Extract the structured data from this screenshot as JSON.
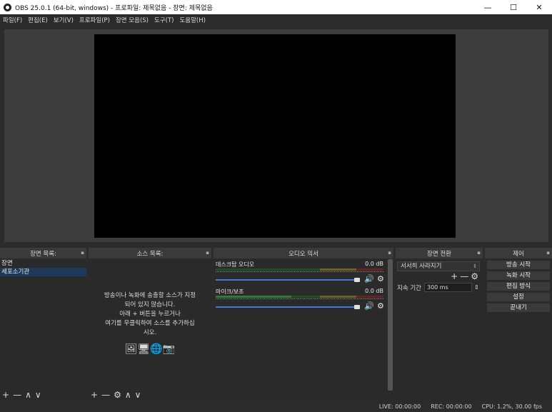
{
  "window": {
    "title": "OBS 25.0.1 (64-bit, windows) - 프로파일: 제목없음 - 장면: 제목없음",
    "minimize": "—",
    "maximize": "☐",
    "close": "✕"
  },
  "menu": [
    "파일(F)",
    "편집(E)",
    "보기(V)",
    "프로파일(P)",
    "장면 모음(S)",
    "도구(T)",
    "도움말(H)"
  ],
  "scenes": {
    "header": "장면 목록:",
    "items": [
      "장면",
      "세포소기관"
    ],
    "toolbar": [
      "+",
      "—",
      "∧",
      "∨"
    ]
  },
  "sources": {
    "header": "소스 목록:",
    "hint_lines": [
      "방송이나 녹화에 송출할 소스가 지정",
      "되어 있지 않습니다.",
      "아래 + 버튼을 누르거나",
      "여기를 우클릭하여 소스를 추가하십",
      "시오."
    ],
    "hint_icons": "🖼🖥🌐📷",
    "toolbar": [
      "+",
      "—",
      "⚙",
      "∧",
      "∨"
    ]
  },
  "mixer": {
    "header": "오디오 믹서",
    "channels": [
      {
        "name": "데스크탑 오디오",
        "db": "0.0 dB",
        "level": 0.0
      },
      {
        "name": "마이크/보조",
        "db": "0.0 dB",
        "level": 0.45
      }
    ],
    "mute_icon": "🔊",
    "settings_icon": "⚙"
  },
  "transitions": {
    "header": "장면 전환",
    "selected": "서서히 사라지기",
    "tools": [
      "+",
      "—",
      "⚙"
    ],
    "duration_label": "지속 기간",
    "duration_value": "300 ms"
  },
  "controls": {
    "header": "제어",
    "buttons": [
      "방송 시작",
      "녹화 시작",
      "편집 방식",
      "설정",
      "끝내기"
    ]
  },
  "status": {
    "live": "LIVE: 00:00:00",
    "rec": "REC: 00:00:00",
    "cpu": "CPU: 1.2%, 30.00 fps"
  },
  "float_icon": "▪",
  "colors": {
    "background": "#2b2b2b",
    "preview_bg": "#3c3c3c",
    "canvas": "#000000",
    "selection": "#1e3a5a",
    "meter_green": "#2e7d32",
    "slider_blue": "#3d7bd6"
  }
}
